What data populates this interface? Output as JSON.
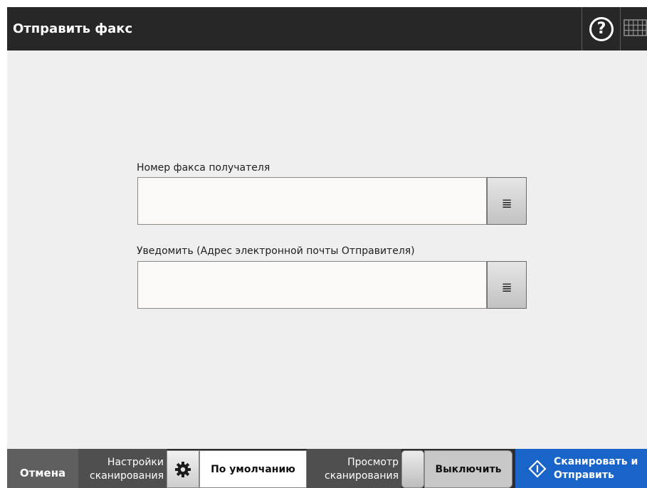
{
  "header": {
    "title": "Отправить факс",
    "help_glyph": "?",
    "icons": [
      "help-icon",
      "keyboard-icon"
    ]
  },
  "form": {
    "fax_number": {
      "label": "Номер факса получателя",
      "value": "",
      "picker_icon": "list-select-icon"
    },
    "notify_email": {
      "label": "Уведомить (Адрес электронной почты Отправителя)",
      "value": "",
      "picker_icon": "list-select-icon"
    }
  },
  "footer": {
    "cancel_label": "Отмена",
    "scan_settings_line1": "Настройки",
    "scan_settings_line2": "сканирования",
    "scan_settings_value": "По умолчанию",
    "scan_preview_line1": "Просмотр",
    "scan_preview_line2": "сканирования",
    "scan_preview_value": "Выключить",
    "scan_send_line1": "Сканировать и",
    "scan_send_line2": "Отправить"
  },
  "colors": {
    "titlebar": "#272727",
    "background": "#efefef",
    "accent_blue": "#1864c8",
    "bottombar": "#2d2d2d"
  }
}
